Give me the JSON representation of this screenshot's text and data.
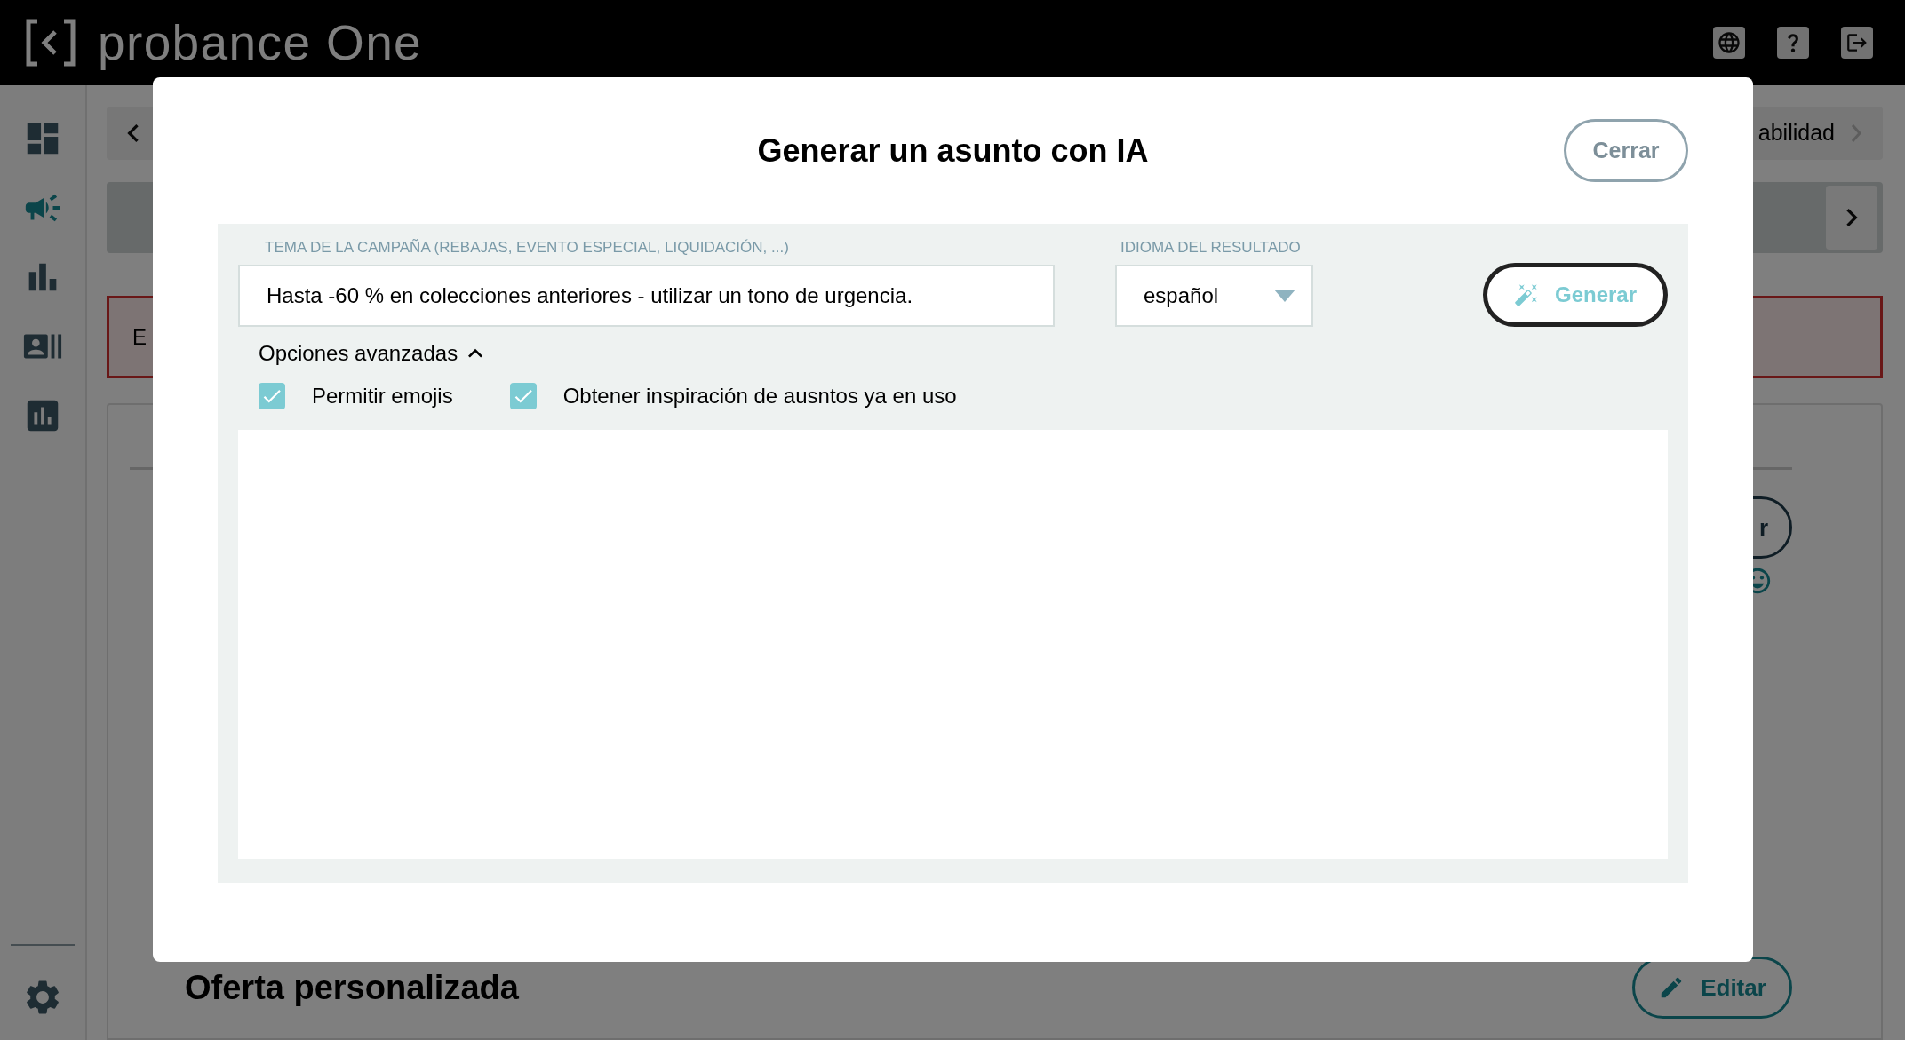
{
  "app": {
    "logo_text": "probance One"
  },
  "sidebar": {
    "items": [
      {
        "kind": "dashboard",
        "selected": false
      },
      {
        "kind": "campaign",
        "selected": true
      },
      {
        "kind": "chart",
        "selected": false
      },
      {
        "kind": "contacts",
        "selected": false
      },
      {
        "kind": "report",
        "selected": false
      }
    ]
  },
  "background": {
    "breadcrumb_end": "abilidad",
    "alert_text": "E",
    "button_fragment": "r",
    "section_title": "Oferta personalizada",
    "edit_button": "Editar"
  },
  "dialog": {
    "title": "Generar un asunto con IA",
    "close_button": "Cerrar",
    "topic": {
      "label": "TEMA DE LA CAMPAÑA (REBAJAS, EVENTO ESPECIAL, LIQUIDACIÓN, ...)",
      "value": "Hasta -60 % en colecciones anteriores - utilizar un tono de urgencia."
    },
    "language": {
      "label": "IDIOMA DEL RESULTADO",
      "value": "español"
    },
    "generate_button": "Generar",
    "advanced": {
      "label": "Opciones avanzadas",
      "expanded": true
    },
    "options": [
      {
        "label": "Permitir emojis",
        "checked": true
      },
      {
        "label": "Obtener inspiración de ausntos ya en uso",
        "checked": true
      }
    ]
  }
}
